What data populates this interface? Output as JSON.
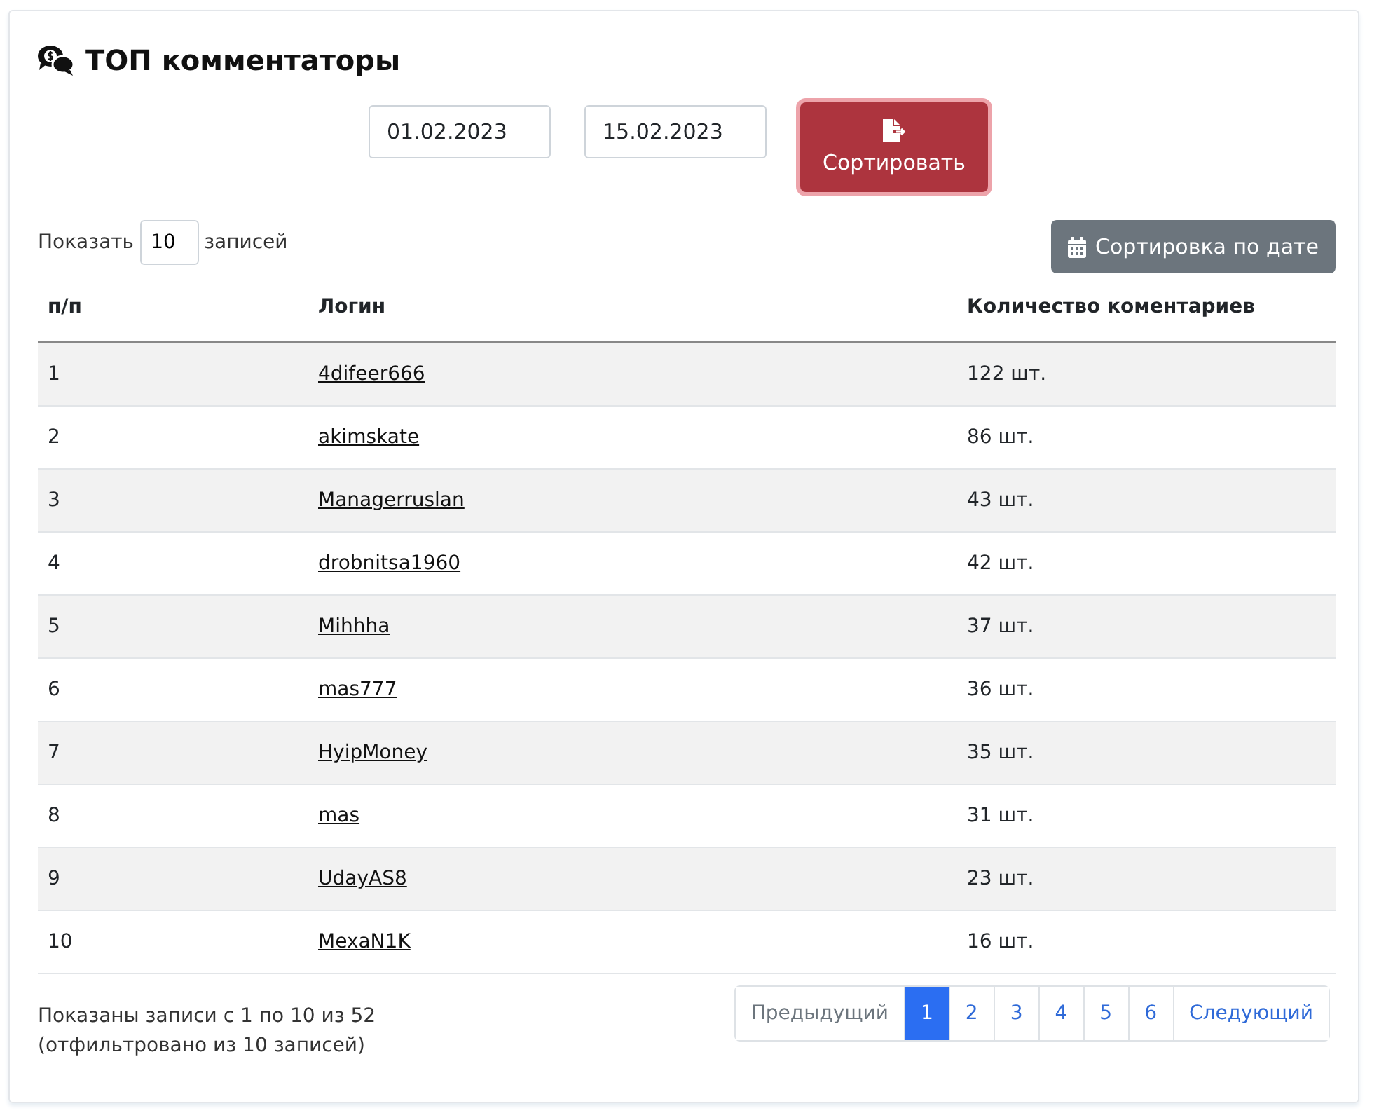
{
  "title": "ТОП комментаторы",
  "filter": {
    "date_from": "01.02.2023",
    "date_to": "15.02.2023",
    "sort_button": "Сортировать"
  },
  "page_length": {
    "before": "Показать",
    "value": "10",
    "after": "записей"
  },
  "date_sort_button": "Сортировка по дате",
  "table": {
    "columns": [
      "п/п",
      "Логин",
      "Количество коментариев"
    ],
    "rows": [
      {
        "num": "1",
        "login": "4difeer666",
        "count": "122 шт."
      },
      {
        "num": "2",
        "login": "akimskate",
        "count": "86 шт."
      },
      {
        "num": "3",
        "login": "Managerruslan",
        "count": "43 шт."
      },
      {
        "num": "4",
        "login": "drobnitsa1960",
        "count": "42 шт."
      },
      {
        "num": "5",
        "login": "Mihhha",
        "count": "37 шт."
      },
      {
        "num": "6",
        "login": "mas777",
        "count": "36 шт."
      },
      {
        "num": "7",
        "login": "HyipMoney",
        "count": "35 шт."
      },
      {
        "num": "8",
        "login": "mas",
        "count": "31 шт."
      },
      {
        "num": "9",
        "login": "UdayAS8",
        "count": "23 шт."
      },
      {
        "num": "10",
        "login": "MexaN1K",
        "count": "16 шт."
      }
    ]
  },
  "info": [
    "Показаны записи с 1 по 10 из 52",
    "(отфильтровано из 10 записей)"
  ],
  "pagination": {
    "previous": {
      "label": "Предыдущий",
      "disabled": true
    },
    "pages": [
      {
        "label": "1",
        "selected": true
      },
      {
        "label": "2",
        "selected": false
      },
      {
        "label": "3",
        "selected": false
      },
      {
        "label": "4",
        "selected": false
      },
      {
        "label": "5",
        "selected": false
      },
      {
        "label": "6",
        "selected": false
      }
    ],
    "next": {
      "label": "Следующий",
      "disabled": false
    }
  }
}
